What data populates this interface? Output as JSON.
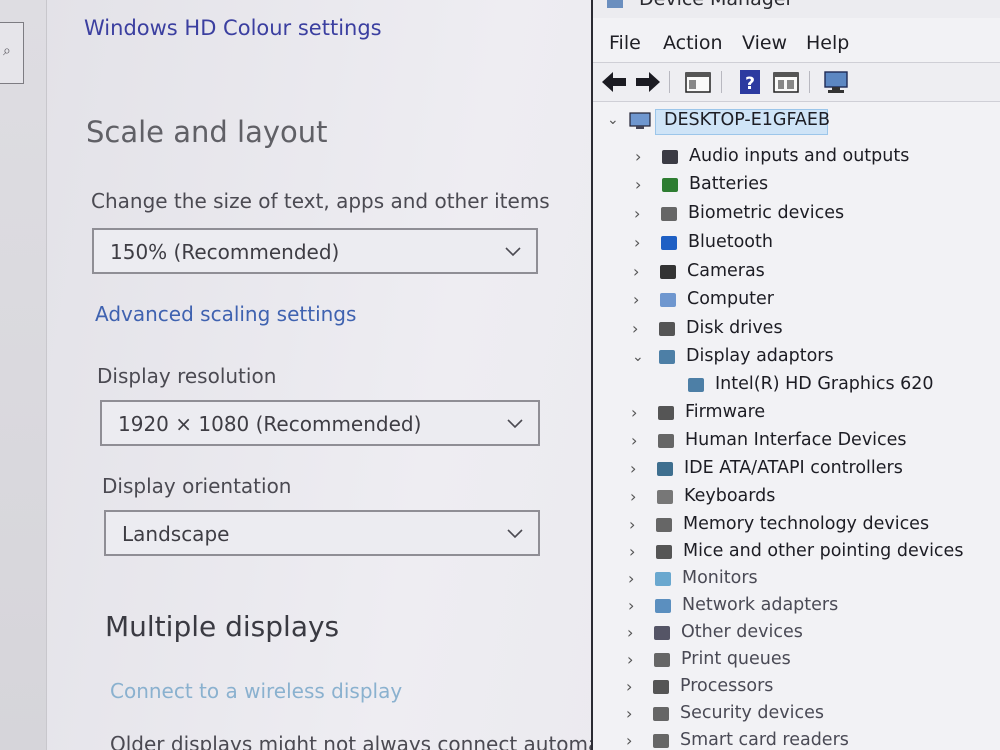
{
  "settings": {
    "hd_colour_link": "Windows HD Colour settings",
    "scale_section_title": "Scale and layout",
    "scale_label": "Change the size of text, apps and other items",
    "scale_value": "150% (Recommended)",
    "advanced_scaling_link": "Advanced scaling settings",
    "resolution_label": "Display resolution",
    "resolution_value": "1920 × 1080 (Recommended)",
    "orientation_label": "Display orientation",
    "orientation_value": "Landscape",
    "multiple_displays_title": "Multiple displays",
    "wireless_link": "Connect to a wireless display",
    "older_displays_text": "Older displays might not always connect automatic"
  },
  "device_manager": {
    "title": "Device Manager",
    "menu": [
      "File",
      "Action",
      "View",
      "Help"
    ],
    "root": "DESKTOP-E1GFAEB",
    "items": [
      {
        "label": "Audio inputs and outputs",
        "icon": "speaker-icon",
        "expanded": false
      },
      {
        "label": "Batteries",
        "icon": "battery-icon",
        "expanded": false
      },
      {
        "label": "Biometric devices",
        "icon": "fingerprint-icon",
        "expanded": false
      },
      {
        "label": "Bluetooth",
        "icon": "bluetooth-icon",
        "expanded": false
      },
      {
        "label": "Cameras",
        "icon": "camera-icon",
        "expanded": false
      },
      {
        "label": "Computer",
        "icon": "computer-icon",
        "expanded": false
      },
      {
        "label": "Disk drives",
        "icon": "disk-drive-icon",
        "expanded": false
      },
      {
        "label": "Display adaptors",
        "icon": "display-adapter-icon",
        "expanded": true
      },
      {
        "label": "Intel(R) HD Graphics 620",
        "icon": "display-adapter-icon",
        "child": true
      },
      {
        "label": "Firmware",
        "icon": "firmware-icon",
        "expanded": false
      },
      {
        "label": "Human Interface Devices",
        "icon": "hid-icon",
        "expanded": false
      },
      {
        "label": "IDE ATA/ATAPI controllers",
        "icon": "ide-controller-icon",
        "expanded": false
      },
      {
        "label": "Keyboards",
        "icon": "keyboard-icon",
        "expanded": false
      },
      {
        "label": "Memory technology devices",
        "icon": "memory-icon",
        "expanded": false
      },
      {
        "label": "Mice and other pointing devices",
        "icon": "mouse-icon",
        "expanded": false
      },
      {
        "label": "Monitors",
        "icon": "monitor-icon",
        "expanded": false
      },
      {
        "label": "Network adapters",
        "icon": "network-icon",
        "expanded": false
      },
      {
        "label": "Other devices",
        "icon": "other-devices-icon",
        "expanded": false
      },
      {
        "label": "Print queues",
        "icon": "printer-icon",
        "expanded": false
      },
      {
        "label": "Processors",
        "icon": "processor-icon",
        "expanded": false
      },
      {
        "label": "Security devices",
        "icon": "security-icon",
        "expanded": false
      },
      {
        "label": "Smart card readers",
        "icon": "smart-card-icon",
        "expanded": false
      }
    ]
  }
}
